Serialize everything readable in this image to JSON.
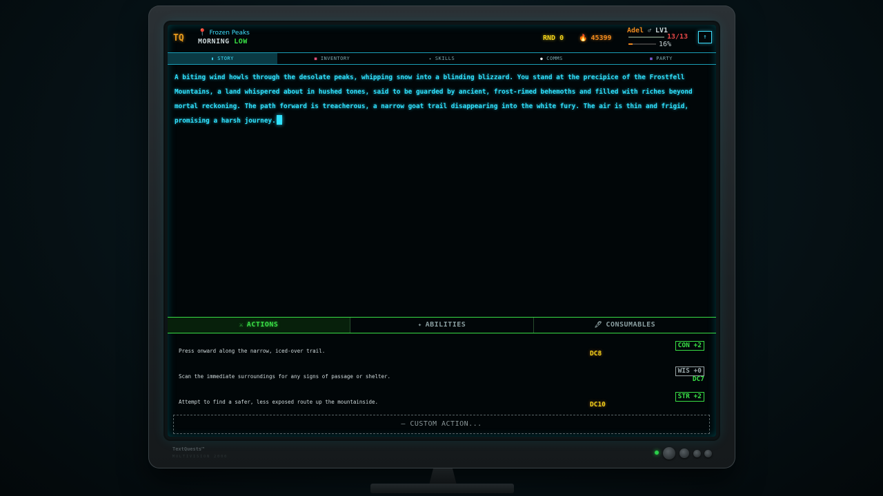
{
  "header": {
    "logo": "TQ",
    "location_icon": "map-pin-icon",
    "location": "Frozen Peaks",
    "time_of_day": "MORNING",
    "time_level": "LOW",
    "round_label": "RND",
    "round_value": "0",
    "gold_icon": "flame-icon",
    "gold_value": "45399",
    "character": {
      "name": "Adel",
      "gender_icon": "♂",
      "level": "LV1",
      "hp": "13/13",
      "xp_percent": "16%",
      "xp_fraction": 0.16
    },
    "menu_icon": "up-arrow-icon"
  },
  "nav": {
    "tabs": [
      {
        "label": "STORY",
        "icon": "book-icon"
      },
      {
        "label": "INVENTORY",
        "icon": "bag-icon"
      },
      {
        "label": "SKILLS",
        "icon": "star-icon"
      },
      {
        "label": "COMMS",
        "icon": "dot-icon"
      },
      {
        "label": "PARTY",
        "icon": "people-icon"
      }
    ],
    "active": "STORY"
  },
  "story": {
    "text": "A biting wind howls through the desolate peaks, whipping snow into a blinding blizzard. You stand at the precipice of the Frostfell Mountains, a land whispered about in hushed tones, said to be guarded by ancient, frost-rimed behemoths and filled with riches beyond mortal reckoning. The path forward is treacherous, a narrow goat trail disappearing into the white fury. The air is thin and frigid, promising a harsh journey."
  },
  "action_tabs": {
    "actions": "ACTIONS",
    "abilities": "ABILITIES",
    "consumables": "CONSUMABLES"
  },
  "actions": [
    {
      "text": "Press onward along the narrow, iced-over trail.",
      "stat": "CON +2",
      "dc": "DC8"
    },
    {
      "text": "Scan the immediate surroundings for any signs of passage or shelter.",
      "stat": "WIS +0",
      "dc": "DC7"
    },
    {
      "text": "Attempt to find a safer, less exposed route up the mountainside.",
      "stat": "STR +2",
      "dc": "DC10"
    }
  ],
  "custom_action": "CUSTOM ACTION...",
  "monitor": {
    "brand": "TextQuests™",
    "brand_sub": "MULTIVISION 2000"
  },
  "colors": {
    "cyan": "#2fe2ff",
    "green": "#39e046",
    "orange": "#f08a1e",
    "yellow": "#f3d31a",
    "red": "#e84848"
  }
}
